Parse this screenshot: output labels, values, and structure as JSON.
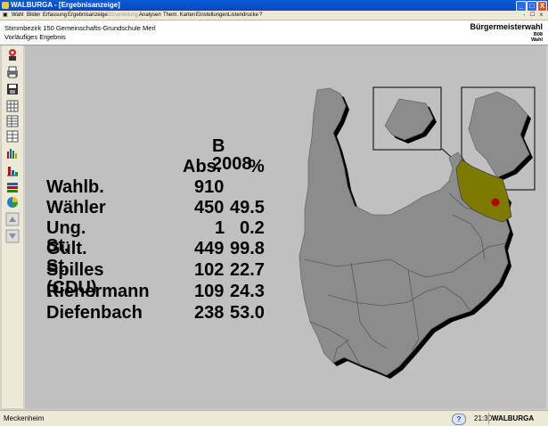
{
  "window": {
    "title": "WALBURGA - [Ergebnisanzeige]",
    "minimize": "_",
    "maximize": "□",
    "close": "X"
  },
  "menu": {
    "items": [
      "Wahl",
      "Bilder",
      "Erfassung",
      "Ergebnisanzeige",
      "Sitzverteilung",
      "Analysen",
      "Them. Karten",
      "Einstellungen",
      "Listendrucke",
      "?"
    ],
    "disabled_item": "Sitzverteilung",
    "mdi_controls": "- ☐ x"
  },
  "header": {
    "district": "Stimmbezirk 150 Gemeinschafts-Grundschule Merl",
    "status": "Vorläufiges Ergebnis",
    "election": "Bürgermeisterwahl",
    "version_line1": "B08",
    "version_line2": "Wahl"
  },
  "results": {
    "title": "B 2008",
    "col_abs": "Abs.",
    "col_pct": "%",
    "rows": [
      {
        "label": "Wahlb.",
        "abs": "910",
        "pct": ""
      },
      {
        "label": "Wähler",
        "abs": "450",
        "pct": "49.5"
      },
      {
        "label": "Ung. St.",
        "abs": "1",
        "pct": "0.2"
      },
      {
        "label": "Gült. St.",
        "abs": "449",
        "pct": "99.8"
      },
      {
        "label": "Spilles (CDU)",
        "abs": "102",
        "pct": "22.7"
      },
      {
        "label": "Rienermann",
        "abs": "109",
        "pct": "24.3"
      },
      {
        "label": "Diefenbach",
        "abs": "238",
        "pct": "53.0"
      }
    ]
  },
  "map": {
    "region_color": "#8c8c8c",
    "shadow_color": "#000000",
    "highlight_color": "#7e7a00",
    "marker_color": "#b00000"
  },
  "status": {
    "location": "Meckenheim",
    "time": "21:30",
    "app": "WALBURGA"
  }
}
